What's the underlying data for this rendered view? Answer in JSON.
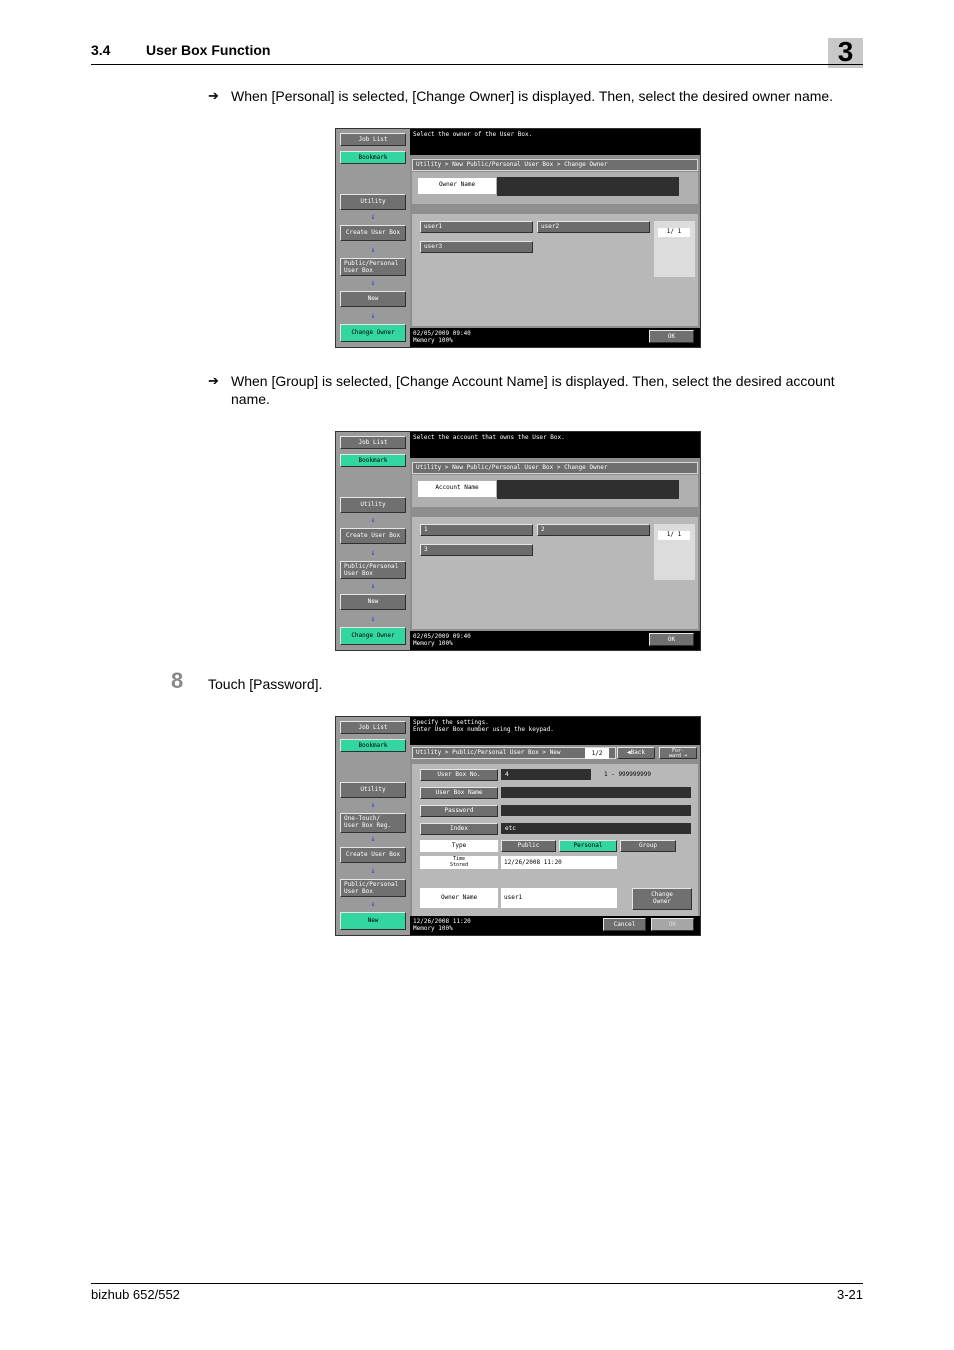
{
  "header": {
    "section_number": "3.4",
    "section_title": "User Box Function",
    "chapter": "3"
  },
  "body": {
    "arrow": "➔",
    "bullet1": "When [Personal] is selected, [Change Owner] is displayed. Then, select the desired owner name.",
    "bullet2_line1": "When [Group] is selected, [Change Account Name] is displayed. Then, select the desired account",
    "bullet2_line2": "name.",
    "step_number": "8",
    "step_text": "Touch [Password]."
  },
  "screen1": {
    "sidebar": {
      "job_list": "Job List",
      "bookmark": "Bookmark",
      "utility": "Utility",
      "create_user_box": "Create User Box",
      "public_personal_1": "Public/Personal",
      "public_personal_2": "User Box",
      "new": "New",
      "change_owner": "Change Owner"
    },
    "message": "Select the owner of the User Box.",
    "breadcrumb": "Utility > New Public/Personal User Box > Change Owner",
    "field_label": "Owner Name",
    "items": [
      "user1",
      "user2",
      "user3"
    ],
    "page": "1/  1",
    "date": "02/05/2009    09:40",
    "memory": "Memory      100%",
    "ok": "OK"
  },
  "screen2": {
    "sidebar": {
      "job_list": "Job List",
      "bookmark": "Bookmark",
      "utility": "Utility",
      "create_user_box": "Create User Box",
      "public_personal_1": "Public/Personal",
      "public_personal_2": "User Box",
      "new": "New",
      "change_owner": "Change Owner"
    },
    "message": "Select the account that owns the User Box.",
    "breadcrumb": "Utility > New Public/Personal User Box > Change Owner",
    "field_label": "Account Name",
    "items": [
      "1",
      "2",
      "3"
    ],
    "page": "1/  1",
    "date": "02/05/2009    09:40",
    "memory": "Memory      100%",
    "ok": "OK"
  },
  "screen3": {
    "sidebar": {
      "job_list": "Job List",
      "bookmark": "Bookmark",
      "utility": "Utility",
      "one_touch_1": "One-Touch/",
      "one_touch_2": "User Box Reg.",
      "create_user_box": "Create User Box",
      "public_personal_1": "Public/Personal",
      "public_personal_2": "User Box",
      "new": "New"
    },
    "message_line1": "Specify the settings.",
    "message_line2": "Enter User Box number using the keypad.",
    "breadcrumb": "Utility > Public/Personal User Box > New",
    "page": "1/2",
    "back": "◀Back",
    "forward_1": "For-",
    "forward_2": "ward ➜",
    "rows": {
      "box_no_label": "User Box No.",
      "box_no_value": "4",
      "box_no_range": "1  -  999999999",
      "box_name_label": "User Box Name",
      "box_name_value": "",
      "password_label": "Password",
      "password_value": "",
      "index_label": "Index",
      "index_value": "etc",
      "type_label": "Type",
      "type_public": "Public",
      "type_personal": "Personal",
      "type_group": "Group",
      "time_label_1": "Time",
      "time_label_2": "Stored",
      "time_value": "12/26/2008    11:20",
      "owner_label": "Owner Name",
      "owner_value": "user1",
      "change_owner_1": "Change",
      "change_owner_2": "Owner"
    },
    "date": "12/26/2008    11:20",
    "memory": "Memory      100%",
    "cancel": "Cancel",
    "ok": "OK"
  },
  "footer": {
    "model": "bizhub 652/552",
    "page": "3-21"
  },
  "colors": {
    "accent_green": "#33d6a0",
    "arrow_blue": "#2440c8"
  }
}
